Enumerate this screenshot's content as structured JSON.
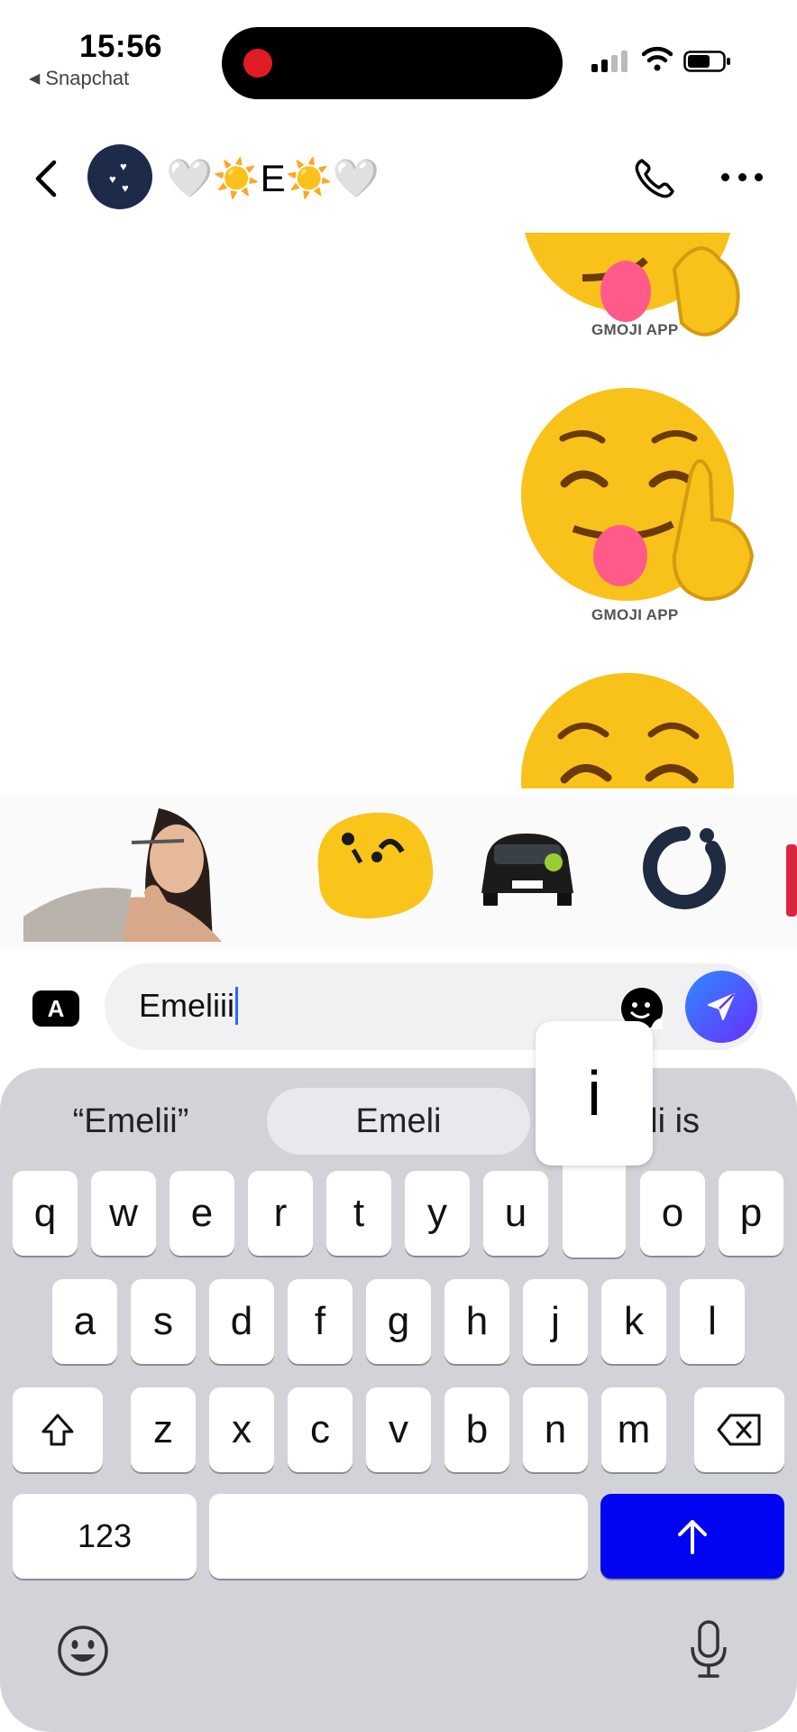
{
  "status_bar": {
    "time": "15:56",
    "back_app": "Snapchat",
    "back_arrow": "◀"
  },
  "header": {
    "chat_name": "🤍☀️E☀️🤍",
    "icons": [
      "back-chevron-icon",
      "phone-icon",
      "more-options-icon"
    ]
  },
  "messages": {
    "stickers": [
      {
        "emoji": "😝",
        "label": "GMOJI APP"
      },
      {
        "emoji": "😝",
        "label": "GMOJI APP"
      },
      {
        "emoji": "😊"
      }
    ]
  },
  "suggestions": [
    {
      "name": "photo-sticker"
    },
    {
      "name": "blob-sticker"
    },
    {
      "name": "car-sticker"
    },
    {
      "name": "loader-sticker"
    }
  ],
  "composer": {
    "a_button": "A",
    "input_value": "Emeliii"
  },
  "keyboard": {
    "predictions": [
      "“Emelii”",
      "Emeli",
      "eli is"
    ],
    "popup_key": "i",
    "row1": [
      "q",
      "w",
      "e",
      "r",
      "t",
      "y",
      "u",
      "i",
      "o",
      "p"
    ],
    "row2": [
      "a",
      "s",
      "d",
      "f",
      "g",
      "h",
      "j",
      "k",
      "l"
    ],
    "row3": [
      "z",
      "x",
      "c",
      "v",
      "b",
      "n",
      "m"
    ],
    "numbers_label": "123",
    "shift_glyph": "⇧",
    "return_glyph": "↑",
    "accent_color": "#0004f0",
    "emoji_glyph": "😀"
  }
}
